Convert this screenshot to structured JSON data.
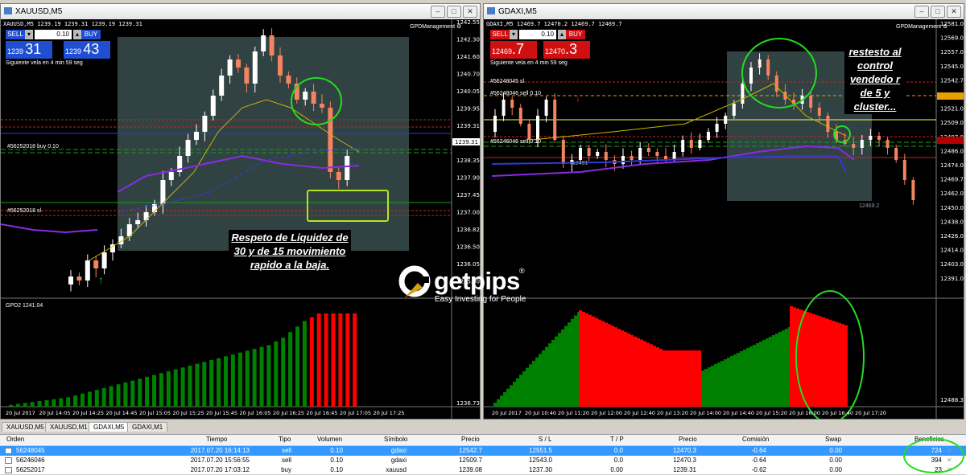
{
  "left": {
    "title": "XAUUSD,M5",
    "ohlc": "XAUUSD,M5  1239.19 1239.31 1239.19 1239.31",
    "sell_label": "SELL",
    "buy_label": "BUY",
    "lot": "0.10",
    "bid_small": "1239",
    "bid_big": "31",
    "ask_small": "1239",
    "ask_big": "43",
    "countdown": "Siguiente vela en 4 min 59 seg",
    "indicator_name": "GPDManagement",
    "order_buy_label": "#56252018 buy 0.10",
    "order_sl_label": "#56252018 sl",
    "price_ticks": [
      "1242.55",
      "1242.30",
      "1241.60",
      "1240.70",
      "1240.05",
      "1239.95",
      "1239.31",
      "1238.85",
      "1238.35",
      "1237.90",
      "1237.45",
      "1237.00",
      "1236.82",
      "1236.50",
      "1236.05",
      "1235.60"
    ],
    "current_price": "1239.31",
    "gpd_label": "GPD2 1241.04",
    "gpd_axis_bottom": "1236.73",
    "time_ticks": [
      "20 Jul 2017",
      "20 Jul 14:05",
      "20 Jul 14:25",
      "20 Jul 14:45",
      "20 Jul 15:05",
      "20 Jul 15:25",
      "20 Jul 15:45",
      "20 Jul 16:05",
      "20 Jul 16:25",
      "20 Jul 16:45",
      "20 Jul 17:05",
      "20 Jul 17:25"
    ],
    "annotation": "Respeto de Liquidez de 30 y de 15 movimiento rapido a la baja."
  },
  "right": {
    "title": "GDAXI,M5",
    "ohlc": "GDAXI,M5  12469.7 12470.2 12469.7 12469.7",
    "sell_label": "SELL",
    "buy_label": "BUY",
    "lot": "0.10",
    "bid_small": "12469",
    "bid_big": ".7",
    "ask_small": "12470",
    "ask_big": ".3",
    "countdown": "Siguiente vela en 4 min 59 seg",
    "indicator_name": "GPDManagement",
    "order_sl_label": "#56248045 sl",
    "order_sell_label": "#56248046 sell 0.10",
    "order_sell2_label": "#56246046 sell 0.10",
    "low_label": "12469.2",
    "level_label": "12491",
    "price_ticks": [
      "12581.0",
      "12569.0",
      "12557.0",
      "12545.0",
      "12542.7",
      "12533.0",
      "12521.0",
      "12509.0",
      "12497.0",
      "12486.0",
      "12474.0",
      "12469.7",
      "12462.0",
      "12450.0",
      "12438.0",
      "12426.0",
      "12414.0",
      "12403.0",
      "12391.0"
    ],
    "gpd_axis_bottom": "12488.3",
    "time_ticks": [
      "20 Jul 2017",
      "20 Jul 10:40",
      "20 Jul 11:20",
      "20 Jul 12:00",
      "20 Jul 12:40",
      "20 Jul 13:20",
      "20 Jul 14:00",
      "20 Jul 14:40",
      "20 Jul 15:20",
      "20 Jul 16:00",
      "20 Jul 16:40",
      "20 Jul 17:20"
    ],
    "annotation": "restesto al control vendedo r de 5 y cluster..."
  },
  "logo": {
    "text": "getpips",
    "registered": "®",
    "tagline": "Easy Investing for People"
  },
  "tabs": [
    "XAUUSD,M5",
    "XAUUSD,M1",
    "GDAXI,M5",
    "GDAXI,M1"
  ],
  "active_tab": 2,
  "table": {
    "headers": [
      "Orden",
      "Tiempo",
      "Tipo",
      "Volumen",
      "Símbolo",
      "Precio",
      "S / L",
      "T / P",
      "Precio",
      "Comisión",
      "Swap",
      "Beneficios"
    ],
    "rows": [
      {
        "orden": "56248045",
        "tiempo": "2017.07.20 16:14:13",
        "tipo": "sell",
        "volumen": "0.10",
        "simbolo": "gdaxi",
        "precio": "12542.7",
        "sl": "12551.5",
        "tp": "0.0",
        "precio2": "12470.3",
        "comision": "-0.64",
        "swap": "0.00",
        "beneficio": "724",
        "selected": true
      },
      {
        "orden": "56246046",
        "tiempo": "2017.07.20 15:56:55",
        "tipo": "sell",
        "volumen": "0.10",
        "simbolo": "gdaxi",
        "precio": "12509.7",
        "sl": "12543.0",
        "tp": "0.0",
        "precio2": "12470.3",
        "comision": "-0.64",
        "swap": "0.00",
        "beneficio": "394",
        "selected": false
      },
      {
        "orden": "56252017",
        "tiempo": "2017.07.20 17:03:12",
        "tipo": "buy",
        "volumen": "0.10",
        "simbolo": "xauusd",
        "precio": "1239.08",
        "sl": "1237.30",
        "tp": "0.00",
        "precio2": "1239.31",
        "comision": "-0.62",
        "swap": "0.00",
        "beneficio": "23",
        "selected": false
      }
    ]
  },
  "colors": {
    "bull": "#ffffff",
    "bear": "#f4845f",
    "hist_green": "#008000",
    "hist_red": "#ff0000",
    "circle_green": "#22dd22",
    "sell_left": "#1f4fd0",
    "sell_right": "#d01010"
  }
}
